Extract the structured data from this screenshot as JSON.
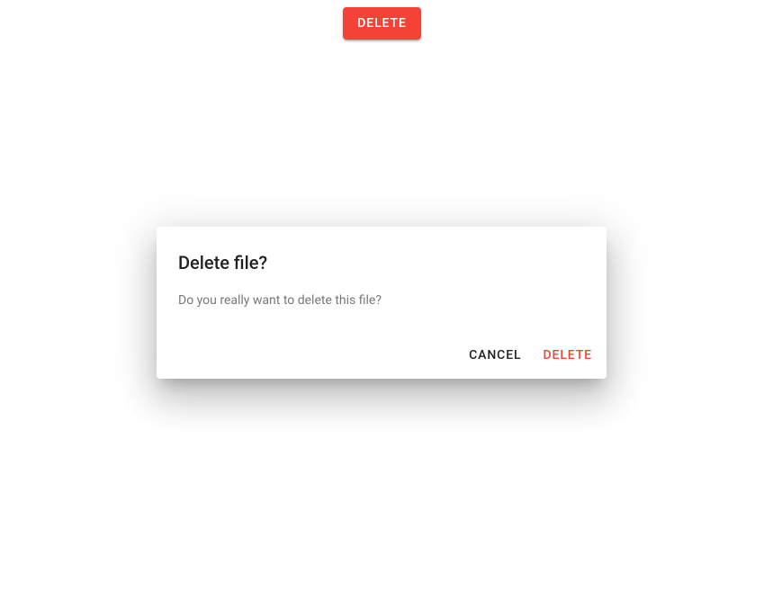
{
  "top_button": {
    "label": "Delete"
  },
  "dialog": {
    "title": "Delete file?",
    "message": "Do you really want to delete this file?",
    "cancel_label": "Cancel",
    "confirm_label": "Delete"
  }
}
